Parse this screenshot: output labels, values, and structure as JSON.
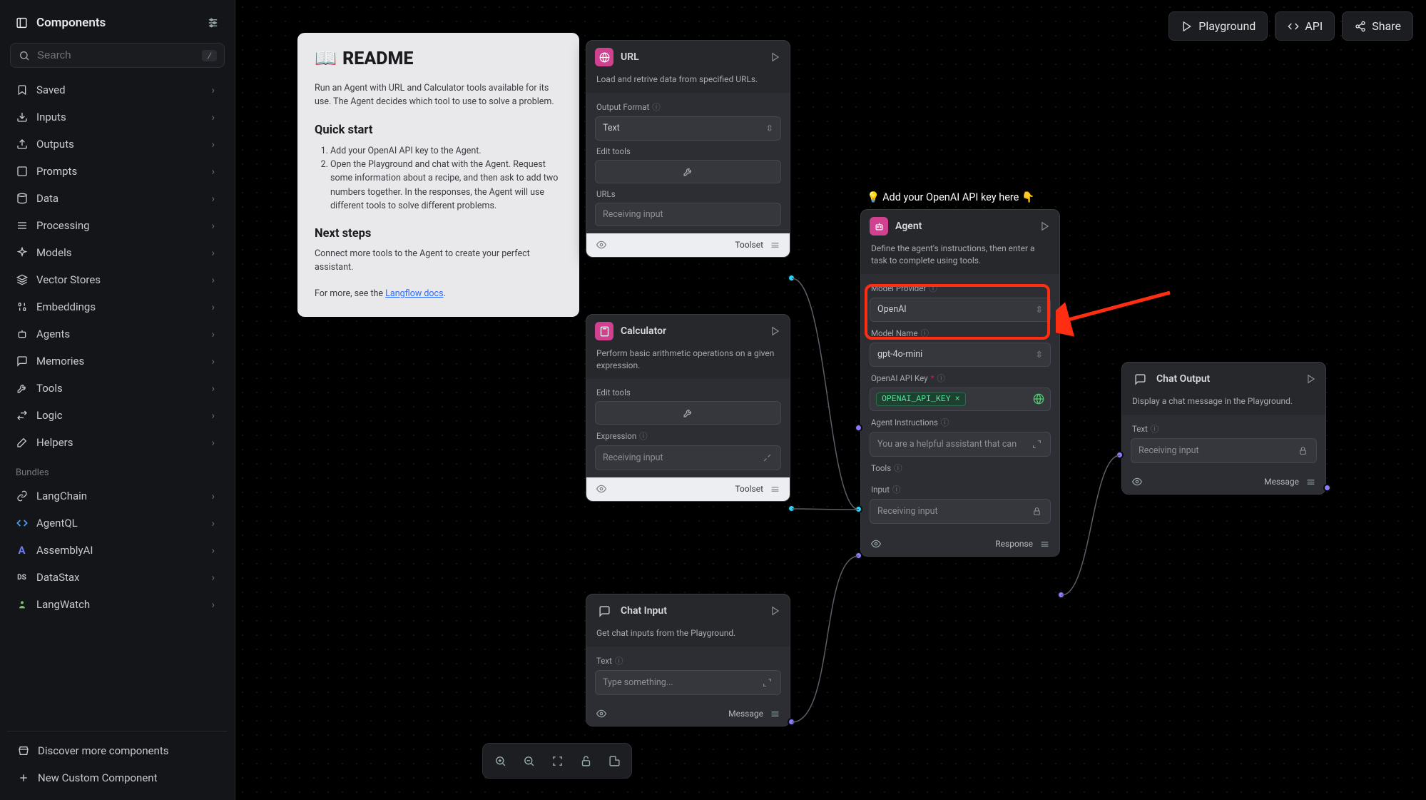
{
  "sidebar": {
    "title": "Components",
    "search_placeholder": "Search",
    "shortcut": "/",
    "items": [
      {
        "label": "Saved",
        "icon": "bookmark"
      },
      {
        "label": "Inputs",
        "icon": "download"
      },
      {
        "label": "Outputs",
        "icon": "upload"
      },
      {
        "label": "Prompts",
        "icon": "square"
      },
      {
        "label": "Data",
        "icon": "database"
      },
      {
        "label": "Processing",
        "icon": "list"
      },
      {
        "label": "Models",
        "icon": "sparkles"
      },
      {
        "label": "Vector Stores",
        "icon": "layers"
      },
      {
        "label": "Embeddings",
        "icon": "binary"
      },
      {
        "label": "Agents",
        "icon": "bot"
      },
      {
        "label": "Memories",
        "icon": "message"
      },
      {
        "label": "Tools",
        "icon": "wrench"
      },
      {
        "label": "Logic",
        "icon": "swap"
      },
      {
        "label": "Helpers",
        "icon": "wand"
      }
    ],
    "bundles_label": "Bundles",
    "bundles": [
      {
        "label": "LangChain",
        "icon": "link"
      },
      {
        "label": "AgentQL",
        "icon": "code"
      },
      {
        "label": "AssemblyAI",
        "icon": "a"
      },
      {
        "label": "DataStax",
        "icon": "ds"
      },
      {
        "label": "LangWatch",
        "icon": "watchman"
      }
    ],
    "footer": {
      "discover": "Discover more components",
      "new_custom": "New Custom Component"
    }
  },
  "top": {
    "playground": "Playground",
    "api": "API",
    "share": "Share"
  },
  "readme": {
    "title": "README",
    "desc": "Run an Agent with URL and Calculator tools available for its use. The Agent decides which tool to use to solve a problem.",
    "quick_heading": "Quick start",
    "steps": [
      "Add your OpenAI API key to the Agent.",
      "Open the Playground and chat with the Agent. Request some information about a recipe, and then ask to add two numbers together. In the responses, the Agent will use different tools to solve different problems."
    ],
    "next_heading": "Next steps",
    "next_desc": "Connect more tools to the Agent to create your perfect assistant.",
    "more_prefix": "For more, see the ",
    "more_link": "Langflow docs"
  },
  "nodes": {
    "url": {
      "title": "URL",
      "sub": "Load and retrive data from specified URLs.",
      "output_format_label": "Output Format",
      "output_format_value": "Text",
      "edit_tools_label": "Edit tools",
      "urls_label": "URLs",
      "urls_placeholder": "Receiving input",
      "footer_label": "Toolset"
    },
    "calc": {
      "title": "Calculator",
      "sub": "Perform basic arithmetic operations on a given expression.",
      "edit_tools_label": "Edit tools",
      "expression_label": "Expression",
      "expression_placeholder": "Receiving input",
      "footer_label": "Toolset"
    },
    "chat_input": {
      "title": "Chat Input",
      "sub": "Get chat inputs from the Playground.",
      "text_label": "Text",
      "text_placeholder": "Type something...",
      "footer_label": "Message"
    },
    "agent": {
      "hint": "Add your OpenAI API key here",
      "title": "Agent",
      "sub": "Define the agent's instructions, then enter a task to complete using tools.",
      "model_provider_label": "Model Provider",
      "model_provider_value": "OpenAI",
      "model_name_label": "Model Name",
      "model_name_value": "gpt-4o-mini",
      "api_key_label": "OpenAI API Key",
      "api_key_value": "OPENAI_API_KEY",
      "instructions_label": "Agent Instructions",
      "instructions_value": "You are a helpful assistant that can",
      "tools_label": "Tools",
      "input_label": "Input",
      "input_placeholder": "Receiving input",
      "footer_label": "Response"
    },
    "chat_output": {
      "title": "Chat Output",
      "sub": "Display a chat message in the Playground.",
      "text_label": "Text",
      "text_placeholder": "Receiving input",
      "footer_label": "Message"
    }
  }
}
